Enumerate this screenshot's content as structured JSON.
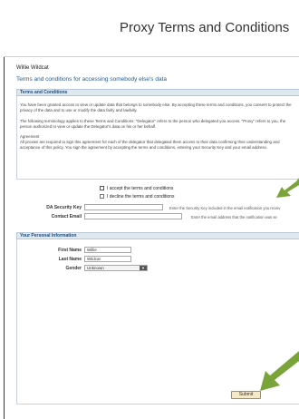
{
  "header": {
    "title": "Proxy Terms and Conditions"
  },
  "user": {
    "name": "Willie Wildcat"
  },
  "page": {
    "terms_heading": "Terms and conditions for accessing somebody else's data"
  },
  "terms": {
    "section_title": "Terms and Conditions",
    "paragraph1": "You have been granted access to view or update data that belongs to somebody else. By accepting these terms and conditions, you consent to protect the privacy of the data and to use or modify the data fairly and lawfully.",
    "paragraph2": "The following terminology applies to these Terms and Conditions: \"Delegator\" refers to the person who delegated you access. \"Proxy\" refers to you, the person authorized to view or update the Delegator's data on his or her behalf.",
    "agreement_label": "Agreement",
    "paragraph3": "All proxies are required to sign this agreement for each of the delegator that delegated them access to their data confirming their understanding and acceptance of this policy. You sign the agreement by accepting the terms and conditions, entering your Security Key and your email address."
  },
  "choices": {
    "accept_label": "I accept the terms and conditions",
    "decline_label": "I decline the terms and conditions"
  },
  "security": {
    "key_label": "DA Security Key",
    "key_value": "",
    "key_hint": "Enter the Security Key included in the email notification you receiv",
    "email_label": "Contact Email",
    "email_value": "",
    "email_hint": "Enter the email address that the notification was se"
  },
  "personal": {
    "section_title": "Your Personal Information",
    "first_name_label": "First Name",
    "first_name_value": "Willie",
    "last_name_label": "Last Name",
    "last_name_value": "Wildcat",
    "gender_label": "Gender",
    "gender_value": "Unknown"
  },
  "actions": {
    "submit_label": "Submit"
  },
  "colors": {
    "arrow": "#7aa33a",
    "section_bar": "#dfe7ef",
    "link_blue": "#1e5a96"
  }
}
